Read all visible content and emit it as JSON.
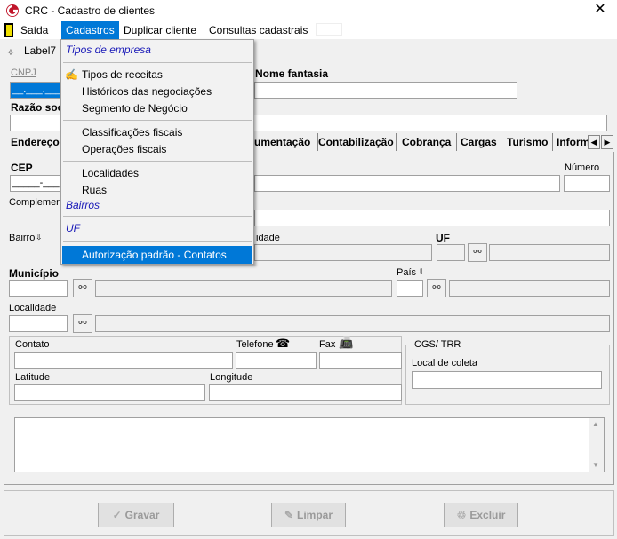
{
  "window": {
    "title": "CRC - Cadastro de clientes",
    "close_glyph": "✕"
  },
  "menubar": {
    "items": [
      {
        "label": "Saída"
      },
      {
        "label": "Cadastros"
      },
      {
        "label": "Duplicar cliente"
      },
      {
        "label": "Consultas cadastrais"
      }
    ]
  },
  "header": {
    "label7": "Label7",
    "cnpj_label": "CNPJ",
    "cnpj_value": "__.___.___/____-__",
    "nome_fantasia_label": "Nome fantasia",
    "razao_social_label": "Razão soc"
  },
  "tabs": {
    "items": [
      {
        "label": "Endereço"
      },
      {
        "label": "umentação"
      },
      {
        "label": "Contabilização"
      },
      {
        "label": "Cobrança"
      },
      {
        "label": "Cargas"
      },
      {
        "label": "Turismo"
      },
      {
        "label": "Inform"
      }
    ],
    "scroll_left": "◀",
    "scroll_right": "▶"
  },
  "address": {
    "cep_label": "CEP",
    "cep_value": "_____-___",
    "numero_label": "Número",
    "complemento_label": "Complement",
    "bairro_label": "Bairro",
    "cidade_label": "idade",
    "uf_label": "UF",
    "municipio_label": "Município",
    "pais_label": "País",
    "localidade_label": "Localidade"
  },
  "contact": {
    "contato_label": "Contato",
    "telefone_label": "Telefone",
    "fax_label": "Fax",
    "latitude_label": "Latitude",
    "longitude_label": "Longitude"
  },
  "cgs_group": {
    "title": "CGS/ TRR",
    "local_coleta_label": "Local de coleta"
  },
  "buttons": {
    "gravar": "Gravar",
    "limpar": "Limpar",
    "excluir": "Excluir"
  },
  "cadastros_menu": {
    "tipos_empresa": "Tipos de empresa",
    "tipos_receitas": "Tipos de receitas",
    "historicos": "Históricos das negociações",
    "segmento": "Segmento de Negócio",
    "classificacoes": "Classificações fiscais",
    "operacoes": "Operações fiscais",
    "localidades": "Localidades",
    "ruas": "Ruas",
    "bairros": "Bairros",
    "uf": "UF",
    "autorizacao": "Autorização padrão - Contatos"
  },
  "colors": {
    "accent": "#0078d7",
    "italic_link": "#1a1ab8"
  },
  "icons": {
    "binoculars": "👓",
    "phone": "☎",
    "fax": "📠",
    "down_arrow": "⇩"
  }
}
